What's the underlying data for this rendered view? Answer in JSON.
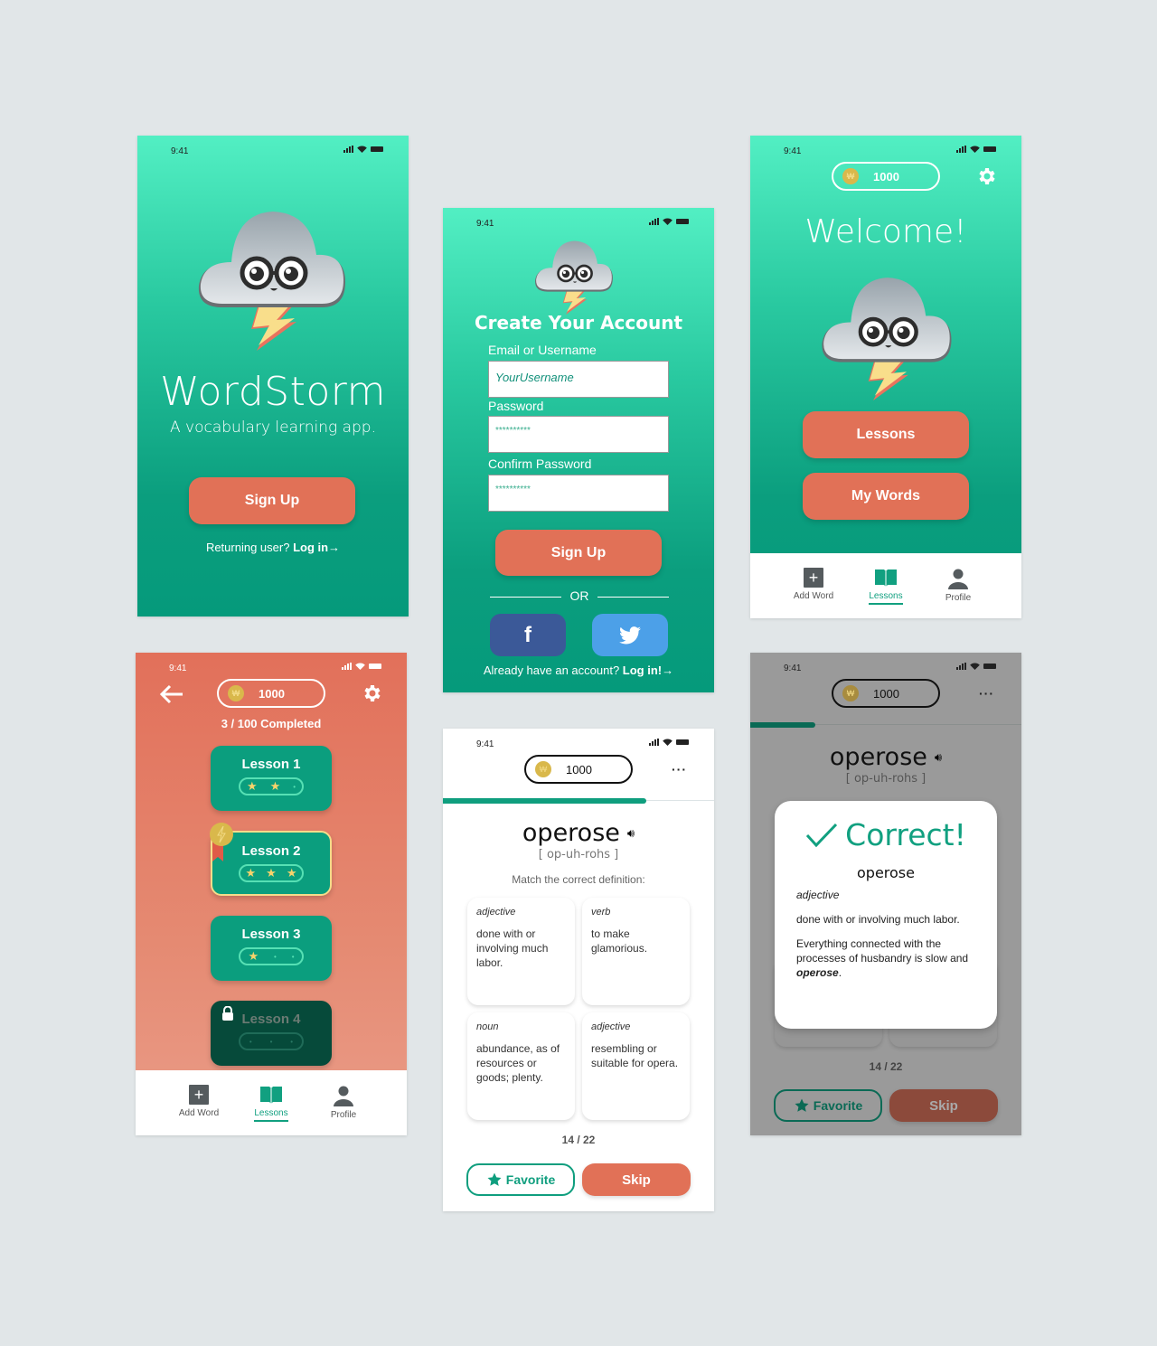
{
  "status_time": "9:41",
  "splash": {
    "title": "WordStorm",
    "subtitle": "A vocabulary learning app.",
    "signup_label": "Sign Up",
    "returning_text": "Returning user? ",
    "login_link": "Log in→"
  },
  "signup": {
    "title": "Create Your Account",
    "email_label": "Email or Username",
    "email_value": "YourUsername",
    "password_label": "Password",
    "password_value": "**********",
    "confirm_label": "Confirm Password",
    "confirm_value": "**********",
    "signup_label": "Sign Up",
    "or_label": "OR",
    "facebook_glyph": "f",
    "already_text": "Already have an account? ",
    "login_link": "Log in!→"
  },
  "welcome": {
    "coins": "1000",
    "title": "Welcome!",
    "lessons_label": "Lessons",
    "mywords_label": "My Words"
  },
  "nav": {
    "items": [
      {
        "label": "Add Word",
        "icon": "plus-square-icon"
      },
      {
        "label": "Lessons",
        "icon": "book-icon",
        "active": true
      },
      {
        "label": "Profile",
        "icon": "person-icon"
      }
    ]
  },
  "lessons": {
    "coins": "1000",
    "progress_text": "3 / 100 Completed",
    "items": [
      {
        "name": "Lesson 1",
        "stars": 2,
        "max_stars": 3,
        "locked": false,
        "badge": false
      },
      {
        "name": "Lesson 2",
        "stars": 3,
        "max_stars": 3,
        "locked": false,
        "badge": true
      },
      {
        "name": "Lesson 3",
        "stars": 1,
        "max_stars": 3,
        "locked": false,
        "badge": false
      },
      {
        "name": "Lesson 4",
        "stars": 0,
        "max_stars": 3,
        "locked": true,
        "badge": false
      }
    ]
  },
  "quiz": {
    "coins": "1000",
    "progress_fraction": 0.75,
    "word": "operose",
    "pronunciation": "[ op-uh-rohs ]",
    "prompt": "Match the correct definition:",
    "options": [
      {
        "pos": "adjective",
        "text": "done with or involving much labor."
      },
      {
        "pos": "verb",
        "text": "to make glamorious."
      },
      {
        "pos": "noun",
        "text": "abundance, as of resources or goods; plenty."
      },
      {
        "pos": "adjective",
        "text": "resembling or suitable for opera."
      }
    ],
    "counter": "14 / 22",
    "favorite_label": "Favorite",
    "skip_label": "Skip"
  },
  "result": {
    "coins": "1000",
    "progress_fraction": 0.24,
    "word": "operose",
    "pronunciation": "[ op-uh-rohs ]",
    "correct_label": "Correct!",
    "modal_word": "operose",
    "pos": "adjective",
    "definition": "done with or involving much labor.",
    "example_prefix": "Everything connected with the processes of husbandry is slow and ",
    "example_word": "operose",
    "example_suffix": ".",
    "counter": "14 / 22",
    "favorite_label": "Favorite",
    "skip_label": "Skip"
  },
  "colors": {
    "primary_green": "#0b9e7e",
    "accent_coral": "#e17157",
    "coin_gold": "#d9b84b",
    "facebook": "#3b5998",
    "twitter": "#4ca0e8"
  }
}
